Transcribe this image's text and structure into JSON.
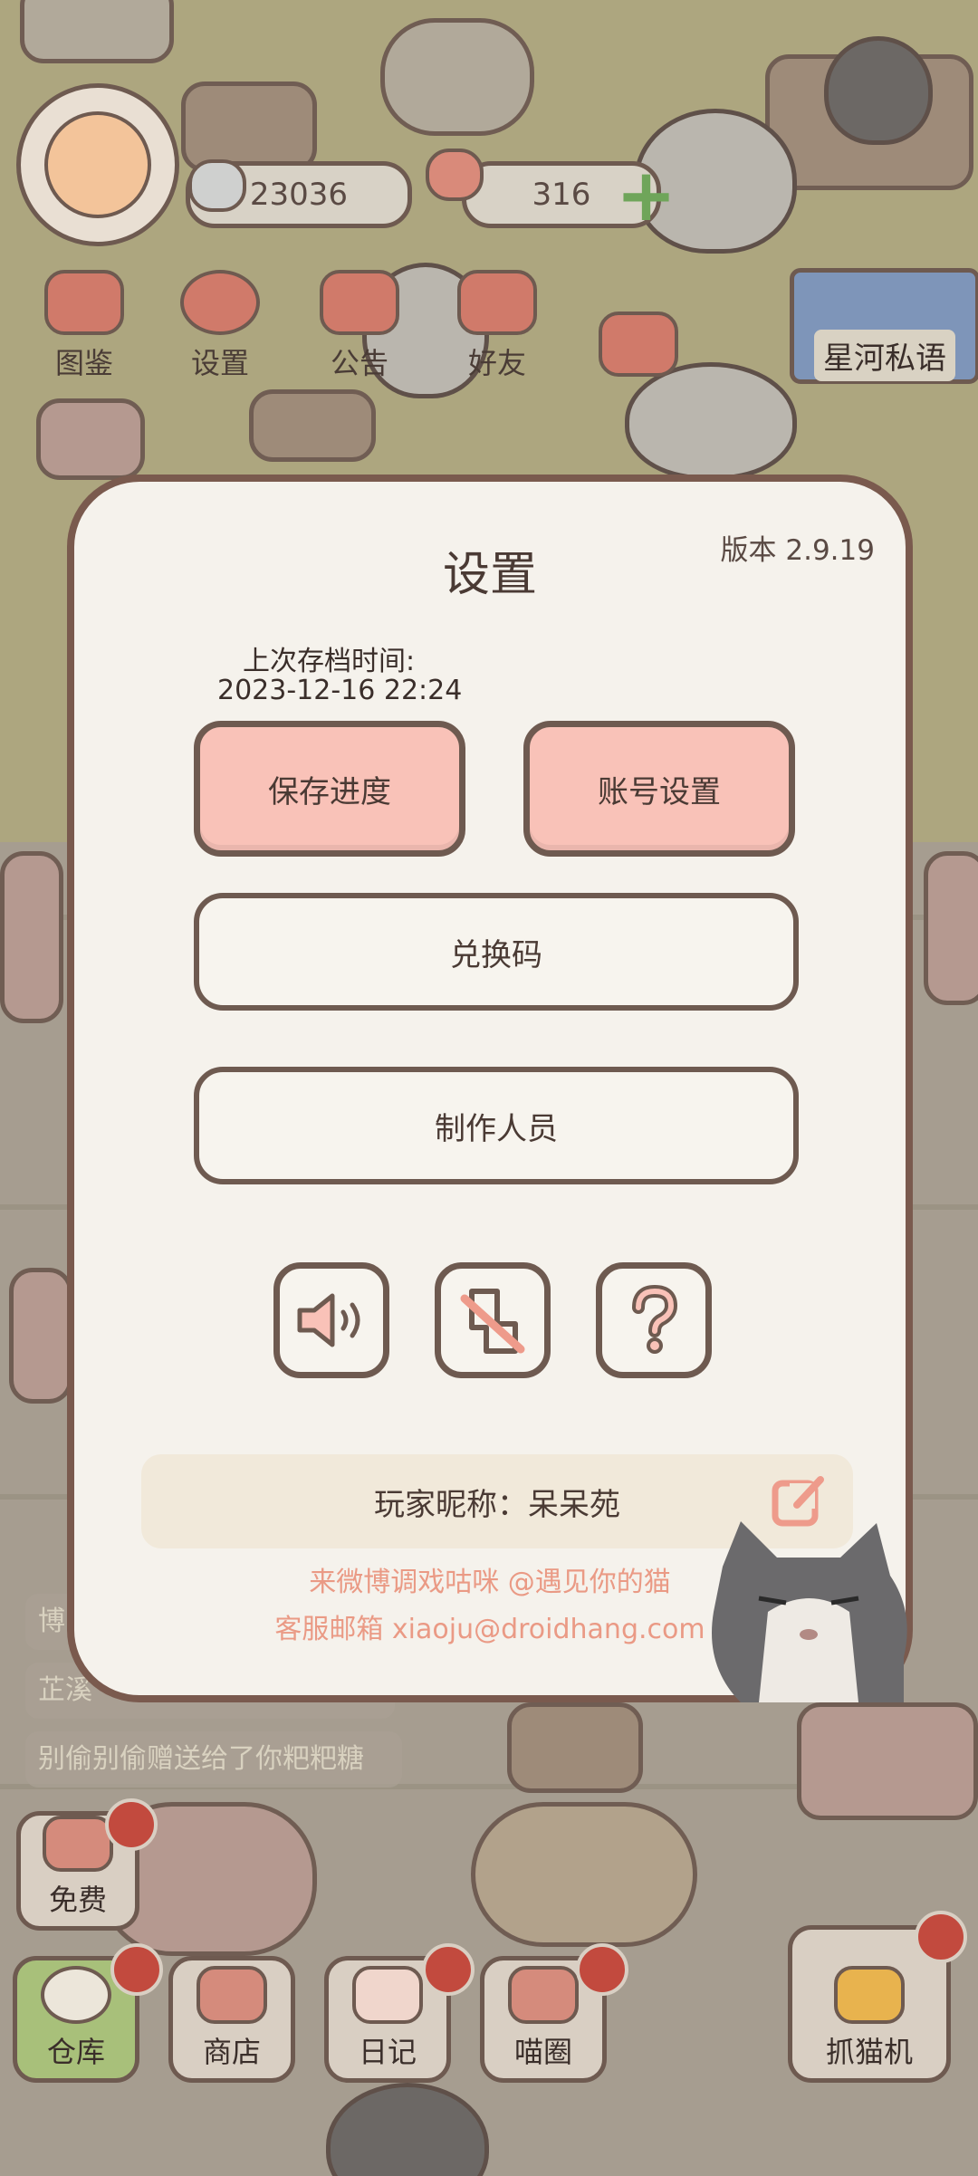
{
  "hud": {
    "coins": "23036",
    "gems": "316",
    "buttons": [
      {
        "label": "图鉴"
      },
      {
        "label": "设置"
      },
      {
        "label": "公告"
      },
      {
        "label": "好友"
      }
    ],
    "event_banner": "星河私语"
  },
  "chat": {
    "lines": [
      "博",
      "芷溪",
      "别偷别偷赠送给了你粑粑糖"
    ]
  },
  "dialog": {
    "title": "设置",
    "version": "版本 2.9.19",
    "last_save_label": "上次存档时间:",
    "last_save_time": "2023-12-16 22:24",
    "save_button": "保存进度",
    "account_button": "账号设置",
    "redeem_button": "兑换码",
    "credits_button": "制作人员",
    "icons": [
      "sound-icon",
      "vibration-off-icon",
      "help-icon"
    ],
    "nickname_label": "玩家昵称：",
    "nickname_value": "呆呆苑",
    "weibo_line": "来微博调戏咕咪 @遇见你的猫",
    "email_line": "客服邮箱 xiaoju@droidhang.com"
  },
  "bottom_nav": {
    "free": "免费",
    "items": [
      "仓库",
      "商店",
      "日记",
      "喵圈"
    ],
    "claw_machine": "抓猫机"
  },
  "colors": {
    "accent_pink": "#f9c2b8",
    "border_brown": "#6e5a50",
    "dialog_bg": "#f5f2ec",
    "link_salmon": "#ea9a85",
    "badge_red": "#c24a3e",
    "active_green": "#a8c07a"
  }
}
